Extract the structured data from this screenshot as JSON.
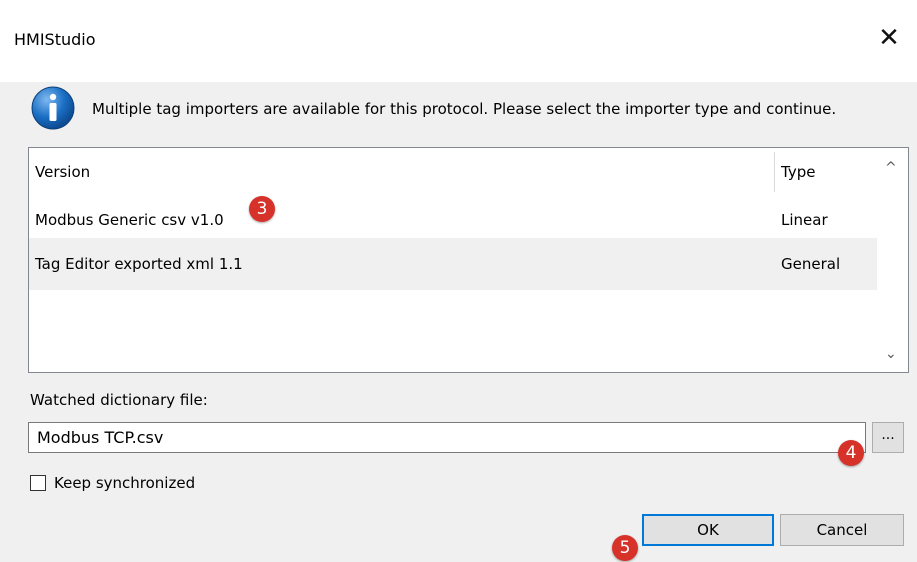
{
  "window": {
    "title": "HMIStudio",
    "close_glyph": "✕"
  },
  "message": "Multiple tag importers are available for this protocol. Please select the importer type and continue.",
  "list": {
    "columns": [
      "Version",
      "Type"
    ],
    "rows": [
      {
        "version": "Modbus Generic csv v1.0",
        "type": "Linear"
      },
      {
        "version": "Tag Editor exported xml 1.1",
        "type": "General"
      }
    ],
    "scroll_up": "^",
    "scroll_down": "⌄"
  },
  "watched_file": {
    "label": "Watched dictionary file:",
    "value": "Modbus TCP.csv",
    "browse_label": "..."
  },
  "keep_synchronized": {
    "label": "Keep synchronized",
    "checked": false
  },
  "buttons": {
    "ok": "OK",
    "cancel": "Cancel"
  },
  "badges": {
    "b3": "3",
    "b4": "4",
    "b5": "5"
  },
  "icons": {
    "info": "info-icon",
    "close": "close-icon"
  },
  "colors": {
    "accent": "#0078d7",
    "badge": "#d7322a",
    "info_icon": "#1a6fc4"
  }
}
